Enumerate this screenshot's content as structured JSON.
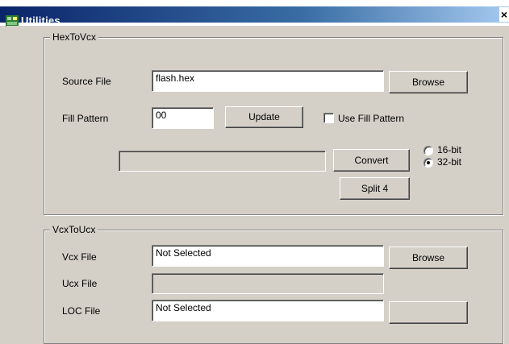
{
  "window": {
    "title": "Utilities",
    "close_glyph": "×",
    "icon": "utilities-app-icon"
  },
  "hex_to_vcx": {
    "legend": "HexToVcx",
    "source_file_label": "Source File",
    "source_file_value": "flash.hex",
    "browse_label": "Browse",
    "fill_pattern_label": "Fill Pattern",
    "fill_pattern_value": "00",
    "update_label": "Update",
    "use_fill_pattern_label": "Use Fill Pattern",
    "use_fill_pattern_checked": false,
    "convert_label": "Convert",
    "split_label": "Split 4",
    "radio_16_label": "16-bit",
    "radio_32_label": "32-bit",
    "selected_bits": "32-bit"
  },
  "vcx_to_ucx": {
    "legend": "VcxToUcx",
    "vcx_file_label": "Vcx File",
    "vcx_file_value": "Not Selected",
    "browse_label": "Browse",
    "ucx_file_label": "Ucx File",
    "ucx_file_value": "",
    "loc_file_label": "LOC File",
    "loc_file_value": "Not Selected"
  }
}
